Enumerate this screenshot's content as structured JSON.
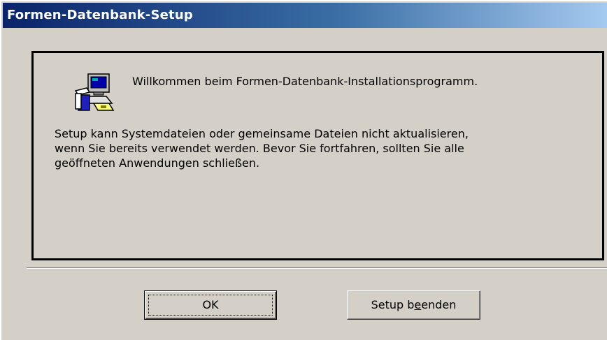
{
  "window": {
    "title": "Formen-Datenbank-Setup"
  },
  "dialog": {
    "icon": "setup-computer-icon",
    "welcome": "Willkommen beim Formen-Datenbank-Installationsprogramm.",
    "message_lines": [
      "Setup kann Systemdateien oder gemeinsame Dateien nicht aktualisieren,",
      "wenn Sie bereits verwendet werden. Bevor Sie fortfahren, sollten Sie alle",
      "geöffneten Anwendungen schließen."
    ]
  },
  "buttons": {
    "ok_label": "OK",
    "exit_prefix": "Setup b",
    "exit_accel": "e",
    "exit_suffix": "enden"
  },
  "colors": {
    "title_gradient_start": "#0a246a",
    "title_gradient_end": "#a6caf0",
    "face": "#d4d0c8"
  }
}
